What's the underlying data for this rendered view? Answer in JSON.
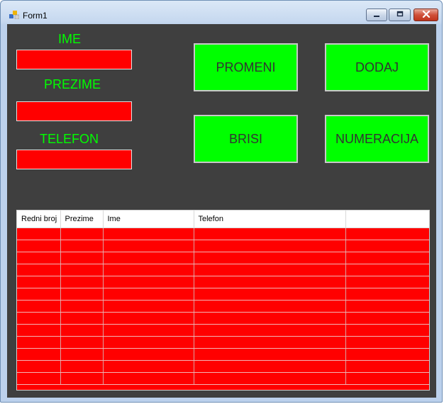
{
  "window": {
    "title": "Form1"
  },
  "colors": {
    "panel": "#3f3f3f",
    "accent_green": "#00ff00",
    "field_red": "#ff0000"
  },
  "form": {
    "ime_label": "IME",
    "prezime_label": "PREZIME",
    "telefon_label": "TELEFON",
    "ime_value": "",
    "prezime_value": "",
    "telefon_value": ""
  },
  "buttons": {
    "promeni": "PROMENI",
    "dodaj": "DODAJ",
    "brisi": "BRISI",
    "numeracija": "NUMERACIJA"
  },
  "grid": {
    "columns": [
      "Redni broj",
      "Prezime",
      "Ime",
      "Telefon",
      ""
    ]
  }
}
